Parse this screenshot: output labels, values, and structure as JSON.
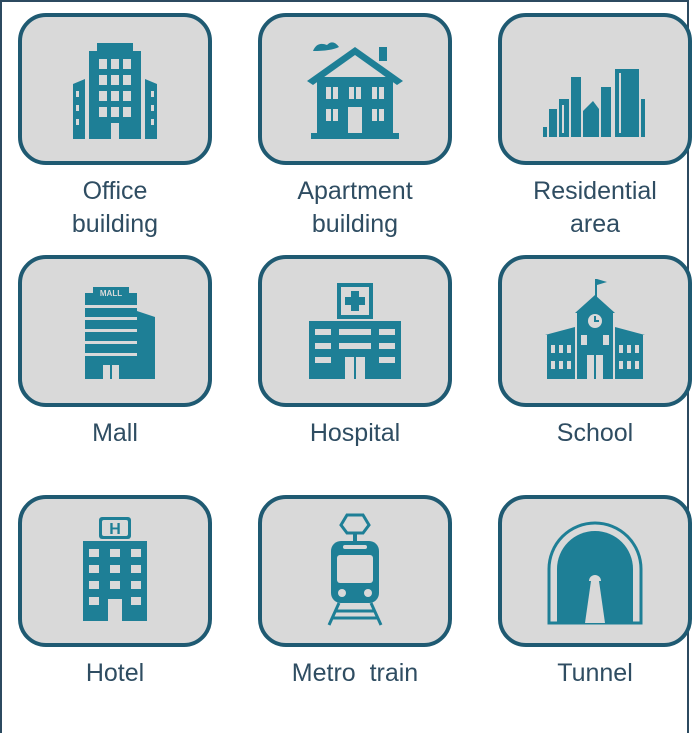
{
  "colors": {
    "accent": "#1e7f96",
    "border": "#1f5a72",
    "tile_bg": "#d9d9d9",
    "text": "#2f4d62"
  },
  "tiles": [
    {
      "label_line1": "Office",
      "label_line2": "building",
      "icon": "office-building-icon"
    },
    {
      "label_line1": "Apartment",
      "label_line2": "building",
      "icon": "apartment-building-icon"
    },
    {
      "label_line1": "Residential",
      "label_line2": "area",
      "icon": "residential-area-icon"
    },
    {
      "label_line1": "Mall",
      "label_line2": "",
      "icon": "mall-icon",
      "sign_text": "MALL"
    },
    {
      "label_line1": "Hospital",
      "label_line2": "",
      "icon": "hospital-icon"
    },
    {
      "label_line1": "School",
      "label_line2": "",
      "icon": "school-icon"
    },
    {
      "label_line1": "Hotel",
      "label_line2": "",
      "icon": "hotel-icon",
      "sign_text": "H"
    },
    {
      "label_line1": "Metro  train",
      "label_line2": "",
      "icon": "metro-train-icon"
    },
    {
      "label_line1": "Tunnel",
      "label_line2": "",
      "icon": "tunnel-icon"
    }
  ]
}
